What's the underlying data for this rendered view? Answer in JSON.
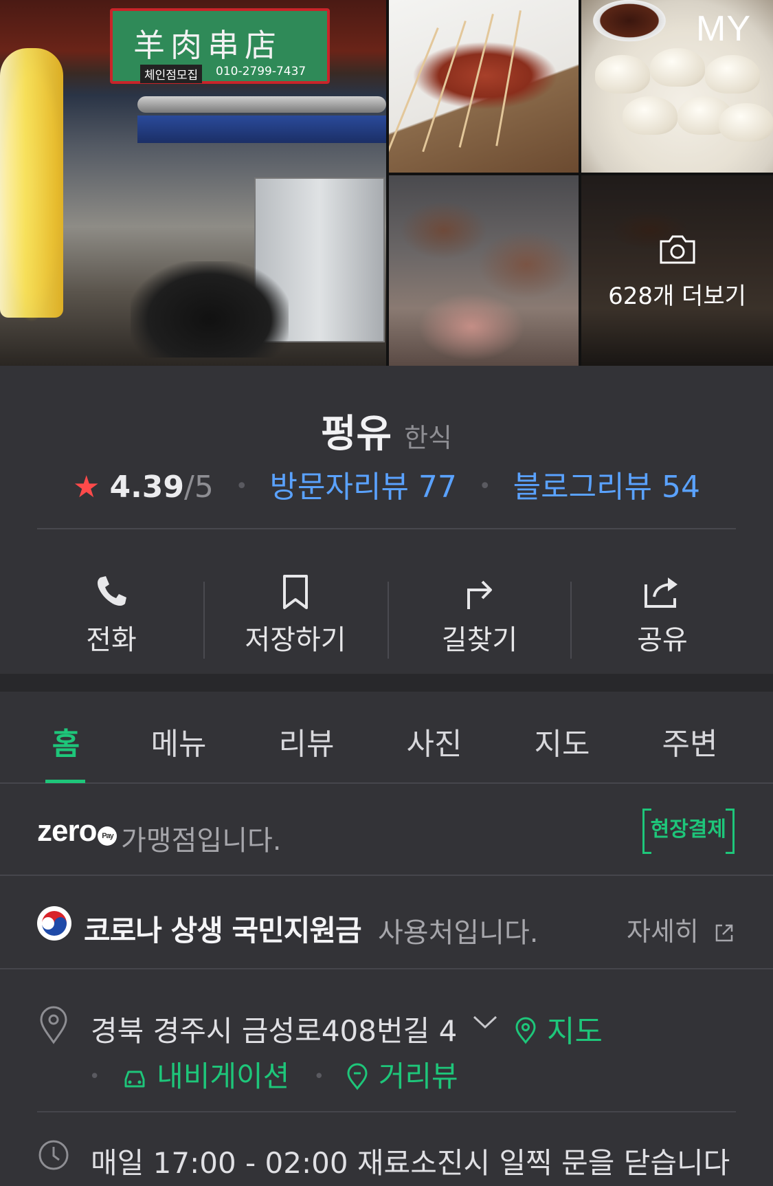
{
  "gallery": {
    "main_sign_text": "羊肉串店",
    "main_sign_sub": "체인점모집",
    "main_sign_phone": "010-2799-7437",
    "more_label": "628개 더보기",
    "my_label": "MY"
  },
  "place": {
    "name": "펑유",
    "category": "한식",
    "rating": "4.39",
    "rating_max": "/5",
    "visitor_reviews": "방문자리뷰 77",
    "blog_reviews": "블로그리뷰 54"
  },
  "actions": [
    {
      "label": "전화",
      "icon": "phone-icon"
    },
    {
      "label": "저장하기",
      "icon": "bookmark-icon"
    },
    {
      "label": "길찾기",
      "icon": "directions-icon"
    },
    {
      "label": "공유",
      "icon": "share-icon"
    }
  ],
  "tabs": [
    {
      "label": "홈",
      "active": true
    },
    {
      "label": "메뉴"
    },
    {
      "label": "리뷰"
    },
    {
      "label": "사진"
    },
    {
      "label": "지도"
    },
    {
      "label": "주변"
    }
  ],
  "zeropay": {
    "logo": "zero",
    "pay": "Pay",
    "text": "가맹점입니다.",
    "badge": "현장결제"
  },
  "corona": {
    "strong": "코로나 상생 국민지원금",
    "tail": "사용처입니다.",
    "detail": "자세히"
  },
  "address": {
    "text": "경북 경주시 금성로408번길 4",
    "map": "지도",
    "navigation": "내비게이션",
    "street_view": "거리뷰"
  },
  "hours": {
    "text": "매일 17:00 - 02:00 재료소진시 일찍 문을 닫습니다"
  },
  "colors": {
    "accent_green": "#1ec67a",
    "link_blue": "#5aa2ff",
    "star_red": "#ff4a4a",
    "background": "#333337"
  }
}
